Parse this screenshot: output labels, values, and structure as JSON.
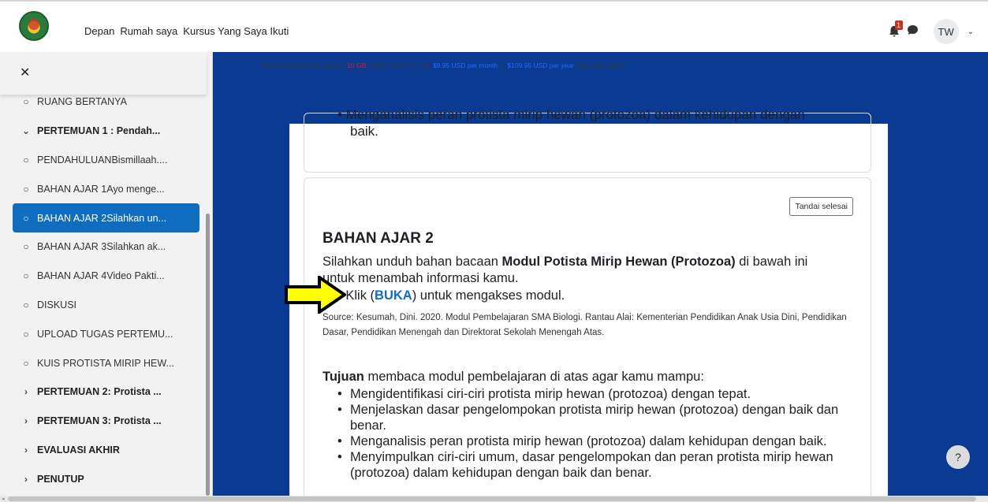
{
  "navbar": {
    "links": [
      "Depan",
      "Rumah saya",
      "Kursus Yang Saya Ikuti"
    ],
    "notification_count": "1",
    "user_initials": "TW"
  },
  "sidebar": {
    "close_symbol": "✕",
    "items": [
      {
        "type": "activity",
        "label": "RUANG BERTANYA"
      },
      {
        "type": "section-open",
        "label": "PERTEMUAN 1 : Pendah..."
      },
      {
        "type": "activity",
        "label": "PENDAHULUANBismillaah...."
      },
      {
        "type": "activity",
        "label": "BAHAN AJAR 1Ayo menge..."
      },
      {
        "type": "activity-active",
        "label": "BAHAN AJAR 2Silahkan un..."
      },
      {
        "type": "activity",
        "label": "BAHAN AJAR 3Silahkan ak..."
      },
      {
        "type": "activity",
        "label": "BAHAN AJAR 4Video Pakti..."
      },
      {
        "type": "activity",
        "label": "DISKUSI"
      },
      {
        "type": "activity",
        "label": "UPLOAD TUGAS PERTEMU..."
      },
      {
        "type": "activity",
        "label": "KUIS PROTISTA MIRIP HEW..."
      },
      {
        "type": "section",
        "label": "PERTEMUAN 2: Protista ..."
      },
      {
        "type": "section",
        "label": "PERTEMUAN 3: Protista ..."
      },
      {
        "type": "section",
        "label": "EVALUASI AKHIR"
      },
      {
        "type": "section",
        "label": "PENUTUP"
      }
    ]
  },
  "ad": {
    "part1": "Remove advertising and get ",
    "highlight": "10 GB",
    "part2": " of disk space for only ",
    "price_month": "$9.95 USD per month",
    "or": " or ",
    "price_year": "$109.95 USD per year",
    "part3": " (plus local taxes)"
  },
  "content": {
    "prev_card_line1": "Menganalisis peran protista mirip hewan (protozoa) dalam kehidupan dengan",
    "prev_card_line2": "baik.",
    "mark_done_button": "Tandai selesai",
    "title": "BAHAN AJAR 2",
    "para_pre": "Silahkan unduh bahan bacaan ",
    "para_bold": "Modul Potista Mirip Hewan (Protozoa)",
    "para_post": " di bawah ini untuk menambah informasi kamu.",
    "klik_pre": "Klik (",
    "klik_link": "BUKA",
    "klik_post": ") untuk mengakses modul.",
    "source": "Source: Kesumah, Dini. 2020. Modul Pembelajaran SMA Biologi. Rantau Alai:  Kementerian Pendidikan Anak Usia Dini, Pendidikan Dasar, Pendidikan Menengah dan Direktorat Sekolah Menengah Atas.",
    "tujuan_bold": "Tujuan",
    "tujuan_rest": " membaca modul pembelajaran di atas agar kamu mampu:",
    "goals": [
      "Mengidentifikasi ciri-ciri protista mirip hewan (protozoa) dengan tepat.",
      "Menjelaskan dasar pengelompokan protista mirip hewan (protozoa) dengan baik dan benar.",
      "Menganalisis peran protista mirip hewan (protozoa) dalam kehidupan dengan baik.",
      "Menyimpulkan ciri-ciri umum, dasar pengelompokan dan peran protista mirip hewan (protozoa) dalam kehidupan dengan baik dan benar."
    ]
  },
  "help_symbol": "?",
  "colors": {
    "brand_blue": "#0f6cbf",
    "main_bg": "#0b3a93",
    "arrow_fill": "#ffff00"
  }
}
